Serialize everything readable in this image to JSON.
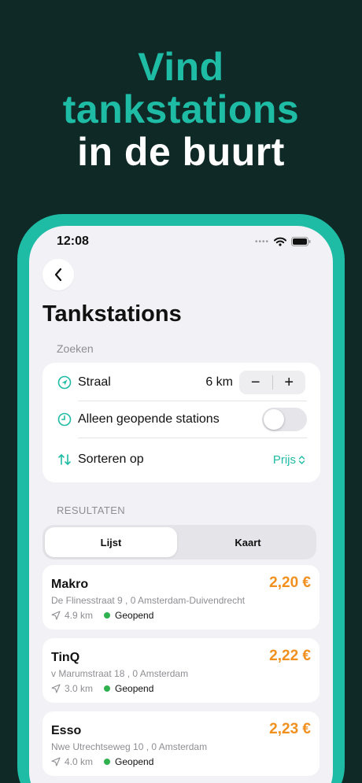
{
  "hero": {
    "line1": "Vind",
    "line2": "tankstations",
    "line3": "in de buurt"
  },
  "statusbar": {
    "time": "12:08"
  },
  "page": {
    "title": "Tankstations"
  },
  "search": {
    "section_label": "Zoeken",
    "radius_label": "Straal",
    "radius_value": "6 km",
    "minus": "−",
    "plus": "+",
    "open_only_label": "Alleen geopende stations",
    "open_only_enabled": false,
    "sort_label": "Sorteren op",
    "sort_value": "Prijs"
  },
  "results": {
    "section_label": "RESULTATEN",
    "tabs": [
      {
        "label": "Lijst",
        "selected": true
      },
      {
        "label": "Kaart",
        "selected": false
      }
    ],
    "stations": [
      {
        "name": "Makro",
        "price": "2,20 €",
        "address": "De Flinesstraat 9 , 0 Amsterdam-Duivendrecht",
        "distance": "4.9 km",
        "status": "Geopend"
      },
      {
        "name": "TinQ",
        "price": "2,22 €",
        "address": "v Marumstraat 18 , 0 Amsterdam",
        "distance": "3.0 km",
        "status": "Geopend"
      },
      {
        "name": "Esso",
        "price": "2,23 €",
        "address": "Nwe Utrechtseweg 10 , 0 Amsterdam",
        "distance": "4.0 km",
        "status": "Geopend"
      }
    ]
  },
  "colors": {
    "accent": "#1ebba5",
    "background": "#0f2a26",
    "price": "#f2901f",
    "open_status": "#2fb14f"
  },
  "icons": [
    "chevron-left-icon",
    "navigation-arrow-icon",
    "clock-icon",
    "sort-arrows-icon",
    "chevron-up-down-icon",
    "location-arrow-icon",
    "wifi-icon",
    "battery-icon"
  ]
}
